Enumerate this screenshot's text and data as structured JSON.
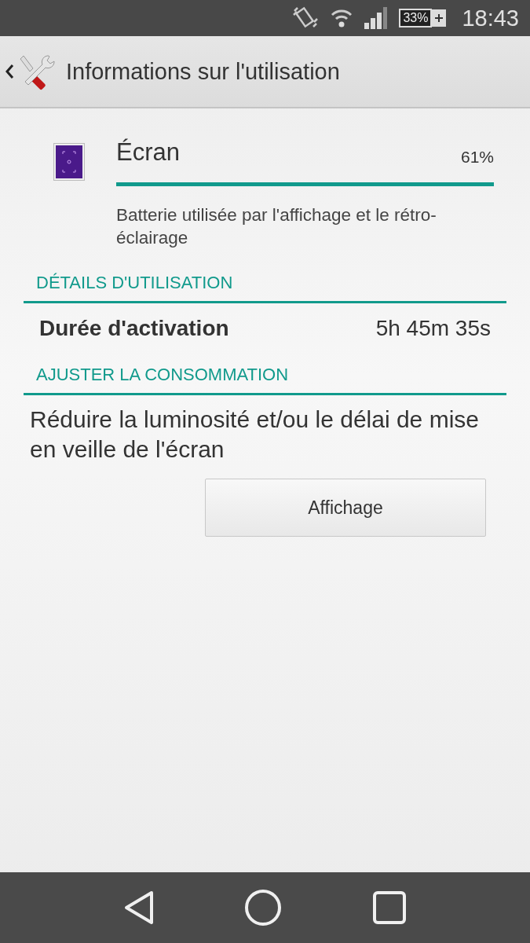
{
  "status_bar": {
    "battery": "33%",
    "time": "18:43"
  },
  "action_bar": {
    "title": "Informations sur l'utilisation"
  },
  "usage": {
    "name": "Écran",
    "percent": "61%",
    "description": "Batterie utilisée par l'affichage et le rétro-éclairage"
  },
  "sections": [
    {
      "title": "DÉTAILS D'UTILISATION",
      "kind": "detail",
      "label": "Durée d'activation",
      "value": "5h 45m 35s"
    },
    {
      "title": "AJUSTER LA CONSOMMATION",
      "kind": "action",
      "text": "Réduire la luminosité et/ou le délai de mise en veille de l'écran",
      "button": "Affichage"
    }
  ]
}
